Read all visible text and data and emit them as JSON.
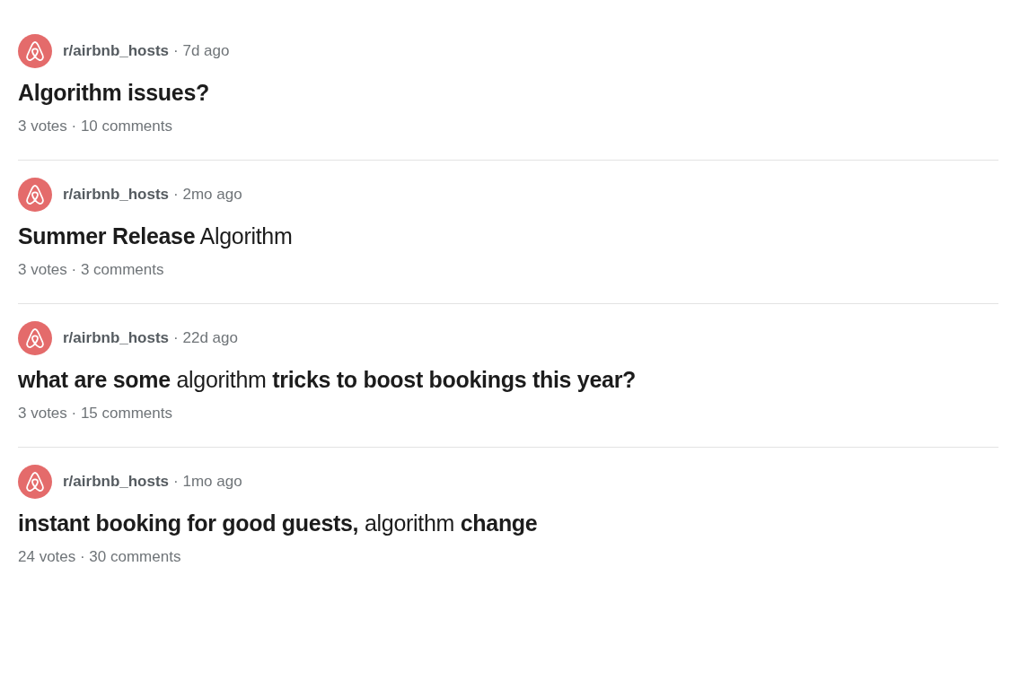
{
  "posts": [
    {
      "subreddit": "r/airbnb_hosts",
      "age": "· 7d ago",
      "title": "**Algorithm issues?**",
      "stats": "3 votes · 10 comments"
    },
    {
      "subreddit": "r/airbnb_hosts",
      "age": "· 2mo ago",
      "title": "**Summer Release** Algorithm",
      "stats": "3 votes · 3 comments"
    },
    {
      "subreddit": "r/airbnb_hosts",
      "age": "· 22d ago",
      "title": "**what are some** algorithm **tricks to boost bookings this year?**",
      "stats": "3 votes · 15 comments"
    },
    {
      "subreddit": "r/airbnb_hosts",
      "age": "· 1mo ago",
      "title": "**instant booking for good guests,** algorithm **change**",
      "stats": "24 votes · 30 comments"
    }
  ]
}
